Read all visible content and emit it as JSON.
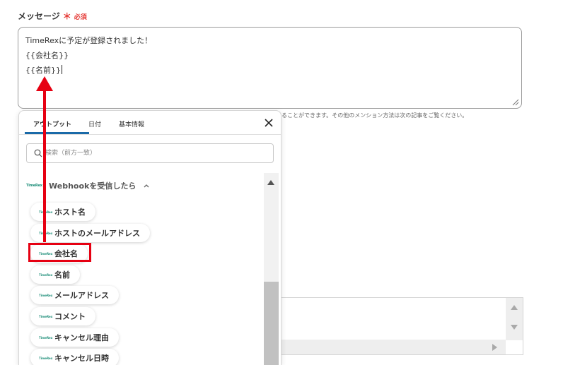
{
  "field": {
    "label": "メッセージ",
    "required_mark": "＊",
    "required_text": "必須"
  },
  "message": {
    "lines": [
      "TimeRexに予定が登録されました！",
      "{{会社名}}",
      "{{名前}}"
    ]
  },
  "helper_text": "ることができます。その他のメンション方法は次の記事をご覧ください。",
  "popup": {
    "tabs": [
      {
        "label": "アウトプット",
        "active": true
      },
      {
        "label": "日付",
        "active": false
      },
      {
        "label": "基本情報",
        "active": false
      }
    ],
    "search_placeholder": "検索（前方一致）",
    "section": {
      "logo_text": "TimeRex",
      "title": "Webhookを受信したら"
    },
    "chip_logo_text": "TimeRex",
    "items": [
      {
        "label": "ホスト名"
      },
      {
        "label": "ホストのメールアドレス"
      },
      {
        "label": "会社名",
        "highlighted": true
      },
      {
        "label": "名前"
      },
      {
        "label": "メールアドレス"
      },
      {
        "label": "コメント"
      },
      {
        "label": "キャンセル理由"
      },
      {
        "label": "キャンセル日時"
      }
    ]
  },
  "colors": {
    "annotation_red": "#e60012",
    "tab_underline": "#1a6aa8",
    "required": "#e53935",
    "logo_teal": "#1f8f7a"
  },
  "icons": {
    "close": "close-icon",
    "search": "search-icon",
    "collapse": "chevron-up-icon",
    "resize": "resize-grip-icon"
  }
}
